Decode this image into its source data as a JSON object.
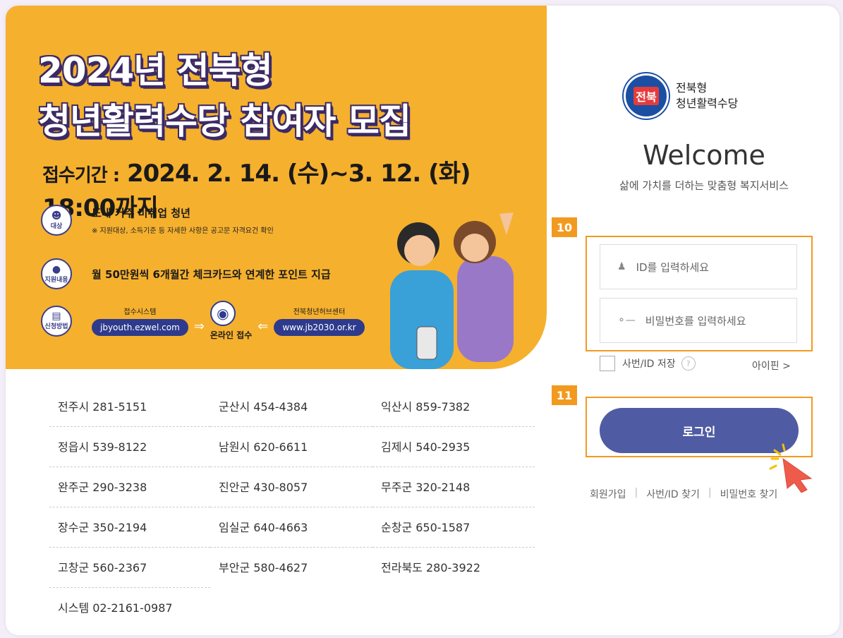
{
  "banner": {
    "title_line1": "2024년 전북형",
    "title_line2": "청년활력수당 참여자 모집",
    "period_label": "접수기간 :",
    "period_value": "2024. 2. 14. (수)~3. 12. (화) 18:00까지",
    "target_icon_label": "대상",
    "target_main": "도내 거주 미취업 청년",
    "target_sub": "※ 지원대상, 소득기준 등 자세한 사항은 공고문 자격요건 확인",
    "support_icon_label": "지원내용",
    "support_main": "월 50만원씩 6개월간 체크카드와 연계한 포인트 지급",
    "apply_icon_label": "신청방법",
    "system_label": "접수시스템",
    "system_url": "jbyouth.ezwel.com",
    "center_label": "전북청년허브센터",
    "center_url": "www.jb2030.or.kr",
    "online_label": "온라인 접수"
  },
  "contacts": [
    [
      "전주시  281-5151",
      "군산시  454-4384",
      "익산시  859-7382"
    ],
    [
      "정읍시  539-8122",
      "남원시  620-6611",
      "김제시  540-2935"
    ],
    [
      "완주군  290-3238",
      "진안군  430-8057",
      "무주군  320-2148"
    ],
    [
      "장수군  350-2194",
      "임실군  640-4663",
      "순창군  650-1587"
    ],
    [
      "고창군  560-2367",
      "부안군  580-4627",
      "전라북도 280-3922"
    ],
    [
      "시스템 02-2161-0987"
    ]
  ],
  "login": {
    "logo_seal_text": "전북",
    "logo_line1": "전북형",
    "logo_line2": "청년활력수당",
    "welcome": "Welcome",
    "subtitle": "삶에 가치를 더하는 맞춤형 복지서비스",
    "id_placeholder": "ID를 입력하세요",
    "pw_placeholder": "비밀번호를 입력하세요",
    "save_id_label": "사번/ID 저장",
    "help": "?",
    "ipin_label": "아이핀 >",
    "login_label": "로그인",
    "signup_label": "회원가입",
    "find_id_label": "사번/ID 찾기",
    "find_pw_label": "비밀번호 찾기",
    "step_badge_fields": "10",
    "step_badge_login": "11"
  },
  "colors": {
    "banner_bg": "#f5b02e",
    "accent_orange": "#f29a1f",
    "login_button": "#4f5ba3",
    "navy": "#2e3a8c"
  }
}
